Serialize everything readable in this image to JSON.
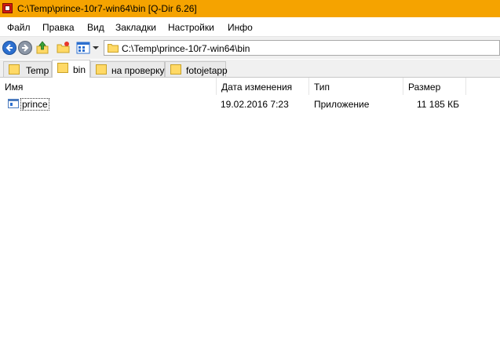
{
  "window": {
    "title": "C:\\Temp\\prince-10r7-win64\\bin  [Q-Dir 6.26]"
  },
  "menu": {
    "items": [
      "Файл",
      "Правка",
      "Вид",
      "Закладки",
      "Настройки",
      "Инфо"
    ]
  },
  "address": {
    "path": "C:\\Temp\\prince-10r7-win64\\bin"
  },
  "tabs": [
    {
      "label": "Temp"
    },
    {
      "label": "bin",
      "active": true
    },
    {
      "label": "на проверку"
    },
    {
      "label": "fotojetapp"
    }
  ],
  "columns": {
    "name": "Имя",
    "date": "Дата изменения",
    "type": "Тип",
    "size": "Размер"
  },
  "files": [
    {
      "name": "prince",
      "date": "19.02.2016 7:23",
      "type": "Приложение",
      "size": "11 185 КБ"
    }
  ],
  "colors": {
    "titlebar": "#f5a300",
    "folder": "#ffd966",
    "back_button": "#2c6fcf"
  },
  "icons": [
    "app-icon",
    "back-icon",
    "forward-icon",
    "up-folder-icon",
    "new-folder-icon",
    "view-icon",
    "chevron-down-icon",
    "folder-icon",
    "application-icon",
    "sort-up-icon"
  ]
}
